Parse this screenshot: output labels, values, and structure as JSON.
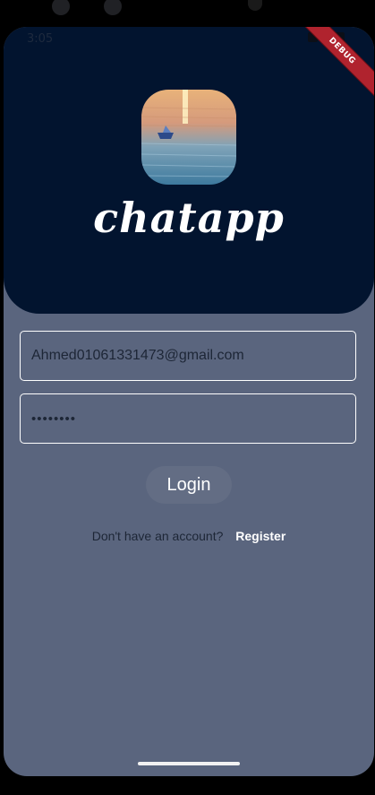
{
  "status_bar": {
    "time": "3:05"
  },
  "debug_banner": "DEBUG",
  "app": {
    "title": "chatapp"
  },
  "login_form": {
    "email_value": "Ahmed01061331473@gmail.com",
    "password_value": "••••••••",
    "login_label": "Login",
    "register_prompt": "Don't have an account?",
    "register_link": "Register"
  },
  "colors": {
    "header_background": "#02142f",
    "page_background": "#5a657e",
    "button_background": "#636d84",
    "debug_banner": "#b0232e"
  }
}
